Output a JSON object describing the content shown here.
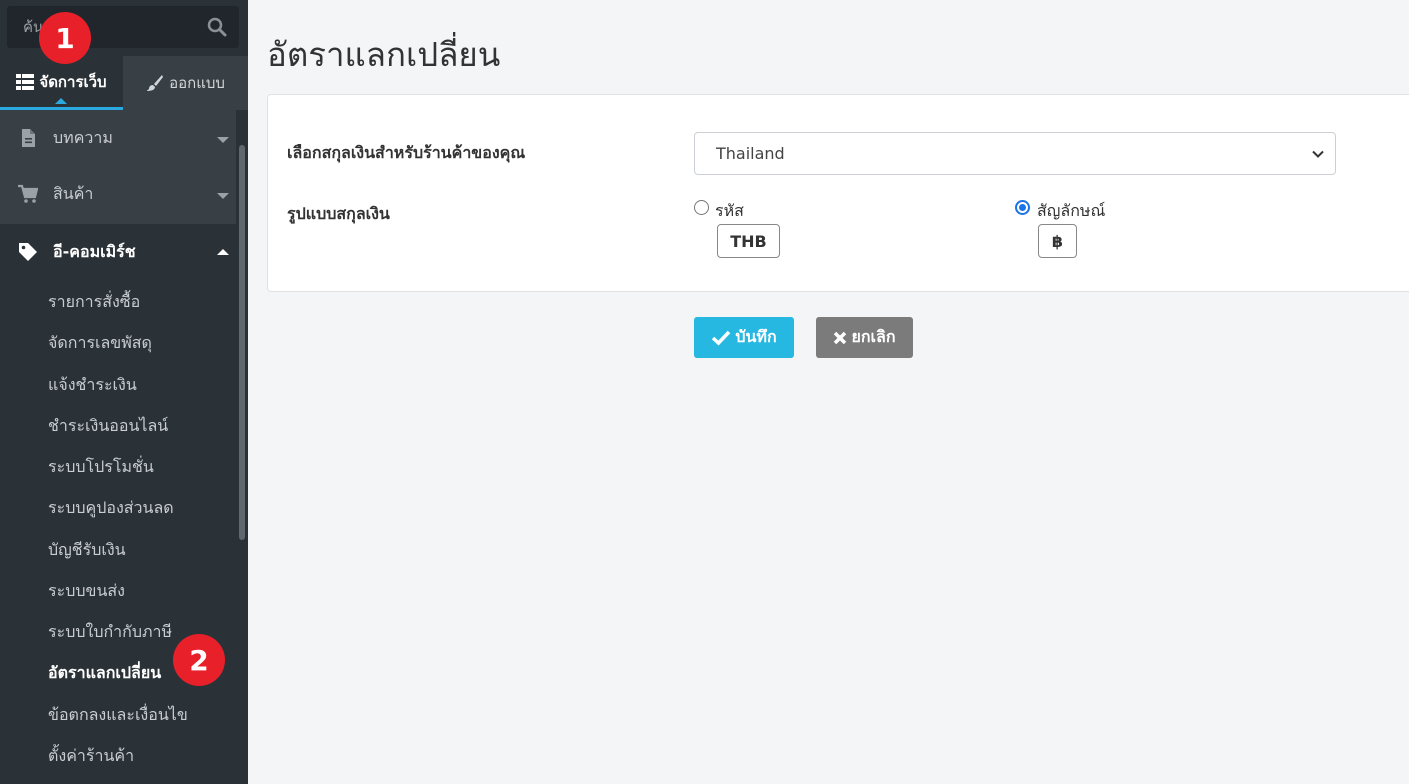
{
  "sidebar": {
    "search": {
      "placeholder": "ค้นหา..."
    },
    "tabs": [
      {
        "label": "จัดการเว็บ",
        "icon": "list-icon",
        "active": true
      },
      {
        "label": "ออกแบบ",
        "icon": "brush-icon",
        "active": false
      }
    ],
    "menu": [
      {
        "label": "บทความ",
        "icon": "file-icon"
      },
      {
        "label": "สินค้า",
        "icon": "cart-icon"
      },
      {
        "label": "อี-คอมเมิร์ช",
        "icon": "tag-icon",
        "expanded": true
      }
    ],
    "submenu": [
      {
        "label": "รายการสั่งซื้อ"
      },
      {
        "label": "จัดการเลขพัสดุ"
      },
      {
        "label": "แจ้งชำระเงิน"
      },
      {
        "label": "ชำระเงินออนไลน์"
      },
      {
        "label": "ระบบโปรโมชั่น"
      },
      {
        "label": "ระบบคูปองส่วนลด"
      },
      {
        "label": "บัญชีรับเงิน"
      },
      {
        "label": "ระบบขนส่ง"
      },
      {
        "label": "ระบบใบกำกับภาษี"
      },
      {
        "label": "อัตราแลกเปลี่ยน",
        "active": true
      },
      {
        "label": "ข้อตกลงและเงื่อนไข"
      },
      {
        "label": "ตั้งค่าร้านค้า"
      }
    ]
  },
  "badges": {
    "one": "1",
    "two": "2"
  },
  "main": {
    "title": "อัตราแลกเปลี่ยน",
    "currency_label": "เลือกสกุลเงินสำหรับร้านค้าของคุณ",
    "currency_value": "Thailand",
    "format_label": "รูปแบบสกุลเงิน",
    "format_options": [
      {
        "label": "รหัส",
        "sample": "THB",
        "checked": false
      },
      {
        "label": "สัญลักษณ์",
        "sample": "฿",
        "checked": true
      }
    ],
    "save_label": "บันทึก",
    "cancel_label": "ยกเลิก"
  },
  "colors": {
    "sidebar_bg": "#2b3237",
    "accent": "#29a9e0",
    "save": "#26b8e1",
    "cancel": "#7b7b7b",
    "badge": "#e8202a"
  }
}
